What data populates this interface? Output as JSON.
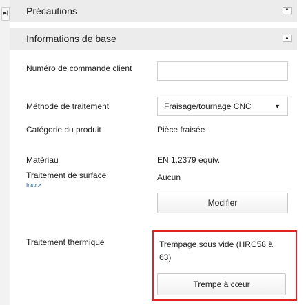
{
  "sections": {
    "precautions": "Précautions",
    "basic_info": "Informations de base"
  },
  "fields": {
    "order_number_label": "Numéro de commande client",
    "order_number_value": "",
    "method_label": "Méthode de traitement",
    "method_value": "Fraisage/tournage CNC",
    "category_label": "Catégorie du produit",
    "category_value": "Pièce fraisée",
    "material_label": "Matériau",
    "material_value": "EN 1.2379 equiv.",
    "surface_label": "Traitement de surface",
    "surface_value": "Aucun",
    "instr_link": "Instr",
    "modify_button": "Modifier",
    "heat_label": "Traitement thermique",
    "heat_value": "Trempage sous vide (HRC58 à 63)",
    "heat_button": "Trempe à cœur"
  },
  "colors": {
    "highlight": "#e02222",
    "link": "#1f5fa8",
    "header_bg": "#ececec"
  }
}
